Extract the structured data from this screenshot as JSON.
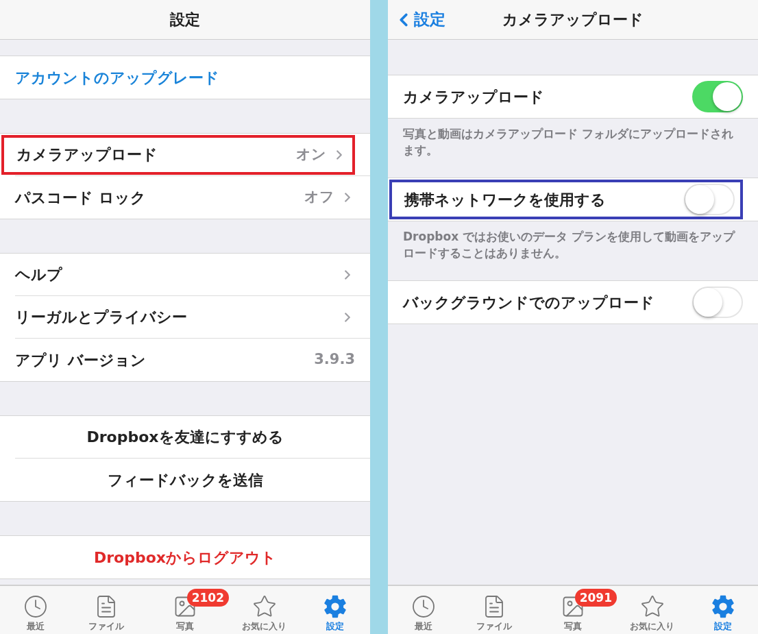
{
  "panels": [
    {
      "kind": "list",
      "nav": {
        "title": "設定"
      },
      "sections": [
        {
          "rows": [
            {
              "kind": "link",
              "label": "アカウントのアップグレード",
              "highlighted": false
            }
          ]
        },
        {
          "rows": [
            {
              "kind": "nav",
              "label": "カメラアップロード",
              "value": "オン",
              "highlighted": true,
              "color": "#e3202a"
            },
            {
              "kind": "nav",
              "label": "パスコード ロック",
              "value": "オフ",
              "highlighted": false
            }
          ]
        },
        {
          "rows": [
            {
              "kind": "nav",
              "label": "ヘルプ",
              "highlighted": false
            },
            {
              "kind": "nav",
              "label": "リーガルとプライバシー",
              "highlighted": false
            },
            {
              "kind": "value",
              "label": "アプリ バージョン",
              "value": "3.9.3",
              "highlighted": false
            }
          ]
        },
        {
          "rows": [
            {
              "kind": "center",
              "label": "Dropboxを友達にすすめる",
              "highlighted": false
            },
            {
              "kind": "center",
              "label": "フィードバックを送信",
              "highlighted": false
            }
          ]
        },
        {
          "rows": [
            {
              "kind": "danger",
              "label": "Dropboxからログアウト",
              "highlighted": false
            }
          ]
        }
      ],
      "tab_bar": [
        {
          "label": "最近",
          "selected": false
        },
        {
          "label": "ファイル",
          "selected": false
        },
        {
          "label": "写真",
          "badge": "2102",
          "selected": false
        },
        {
          "label": "お気に入り",
          "selected": false
        },
        {
          "label": "設定",
          "selected": true
        }
      ]
    },
    {
      "kind": "detail",
      "nav": {
        "back": "設定",
        "title": "カメラアップロード"
      },
      "sections": [
        {
          "rows": [
            {
              "kind": "toggle",
              "label": "カメラアップロード",
              "on": true,
              "highlighted": false
            }
          ],
          "footer": "写真と動画はカメラアップロード フォルダにアップロードされます。"
        },
        {
          "rows": [
            {
              "kind": "toggle",
              "label": "携帯ネットワークを使用する",
              "on": false,
              "highlighted": true,
              "color": "#3a3fb5"
            }
          ],
          "footer": "Dropbox ではお使いのデータ プランを使用して動画をアップロードすることはありません。"
        },
        {
          "rows": [
            {
              "kind": "toggle",
              "label": "バックグラウンドでのアップロード",
              "on": false,
              "highlighted": false
            }
          ]
        }
      ],
      "tab_bar": [
        {
          "label": "最近",
          "selected": false
        },
        {
          "label": "ファイル",
          "selected": false
        },
        {
          "label": "写真",
          "badge": "2091",
          "selected": false
        },
        {
          "label": "お気に入り",
          "selected": false
        },
        {
          "label": "設定",
          "selected": true
        }
      ]
    }
  ]
}
